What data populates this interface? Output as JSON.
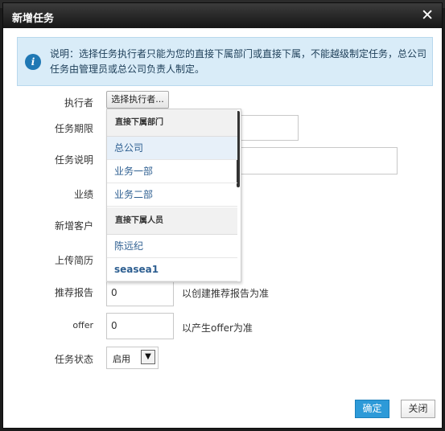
{
  "dialog": {
    "title": "新增任务",
    "close_symbol": "✕"
  },
  "notice": {
    "icon": "info-icon",
    "icon_glyph": "i",
    "text": "说明：选择任务执行者只能为您的直接下属部门或直接下属，不能越级制定任务，总公司任务由管理员或总公司负责人制定。"
  },
  "form": {
    "executor_label": "执行者",
    "executor_button": "选择执行者...",
    "period_label": "任务期限",
    "desc_label": "任务说明",
    "performance_label": "业绩",
    "new_customer_label": "新增客户",
    "upload_resume_label": "上传简历",
    "recommend_report_label": "推荐报告",
    "recommend_report_value": "0",
    "recommend_report_hint": "以创建推荐报告为准",
    "offer_label": "offer",
    "offer_value": "0",
    "offer_hint": "以产生offer为准",
    "status_label": "任务状态",
    "status_value": "启用",
    "status_arrow": "▼"
  },
  "dropdown": {
    "dept_header": "直接下属部门",
    "departments": [
      "总公司",
      "业务一部",
      "业务二部"
    ],
    "staff_header": "直接下属人员",
    "staff": [
      "陈远纪",
      "seasea1"
    ]
  },
  "buttons": {
    "confirm": "确定",
    "close": "关闭"
  },
  "colors": {
    "titlebar": "#1e1e1e",
    "notice_bg": "#d9ecf8",
    "primary": "#2d9ad8",
    "link": "#2e5f91"
  }
}
